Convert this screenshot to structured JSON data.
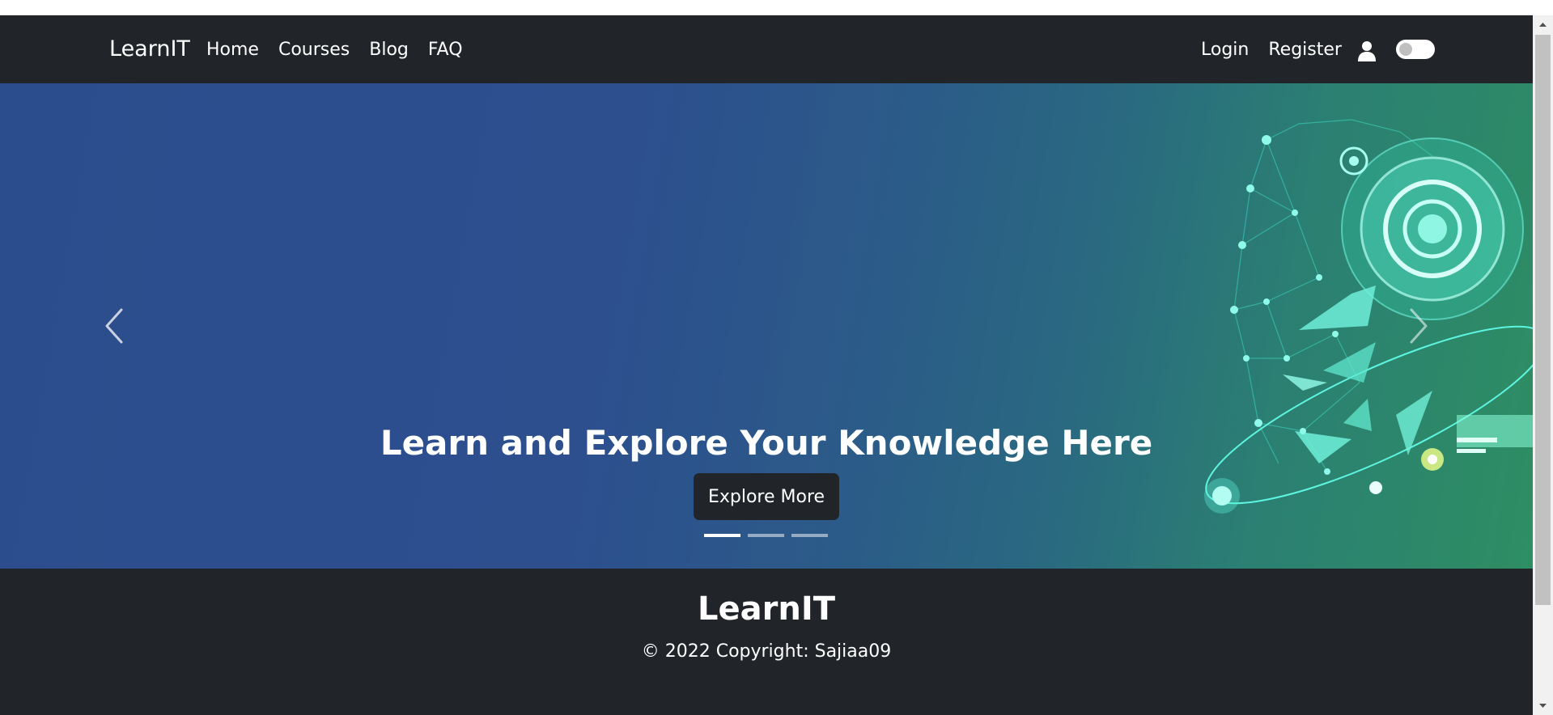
{
  "navbar": {
    "brand": "LearnIT",
    "links": [
      "Home",
      "Courses",
      "Blog",
      "FAQ"
    ],
    "right_links": [
      "Login",
      "Register"
    ],
    "user_icon": "user-icon",
    "theme_toggle_on": false
  },
  "hero": {
    "caption": "Learn and Explore Your Knowledge Here",
    "button_label": "Explore More",
    "slide_count": 3,
    "active_slide": 1,
    "prev_icon": "chevron-left-icon",
    "next_icon": "chevron-right-icon"
  },
  "footer": {
    "title": "LearnIT",
    "copyright": "© 2022 Copyright: Sajiaa09"
  },
  "colors": {
    "navbar": "#212529",
    "hero_start": "#2c4d8d",
    "hero_end": "#2e8e63",
    "accent_glow": "#4ef0d0"
  }
}
